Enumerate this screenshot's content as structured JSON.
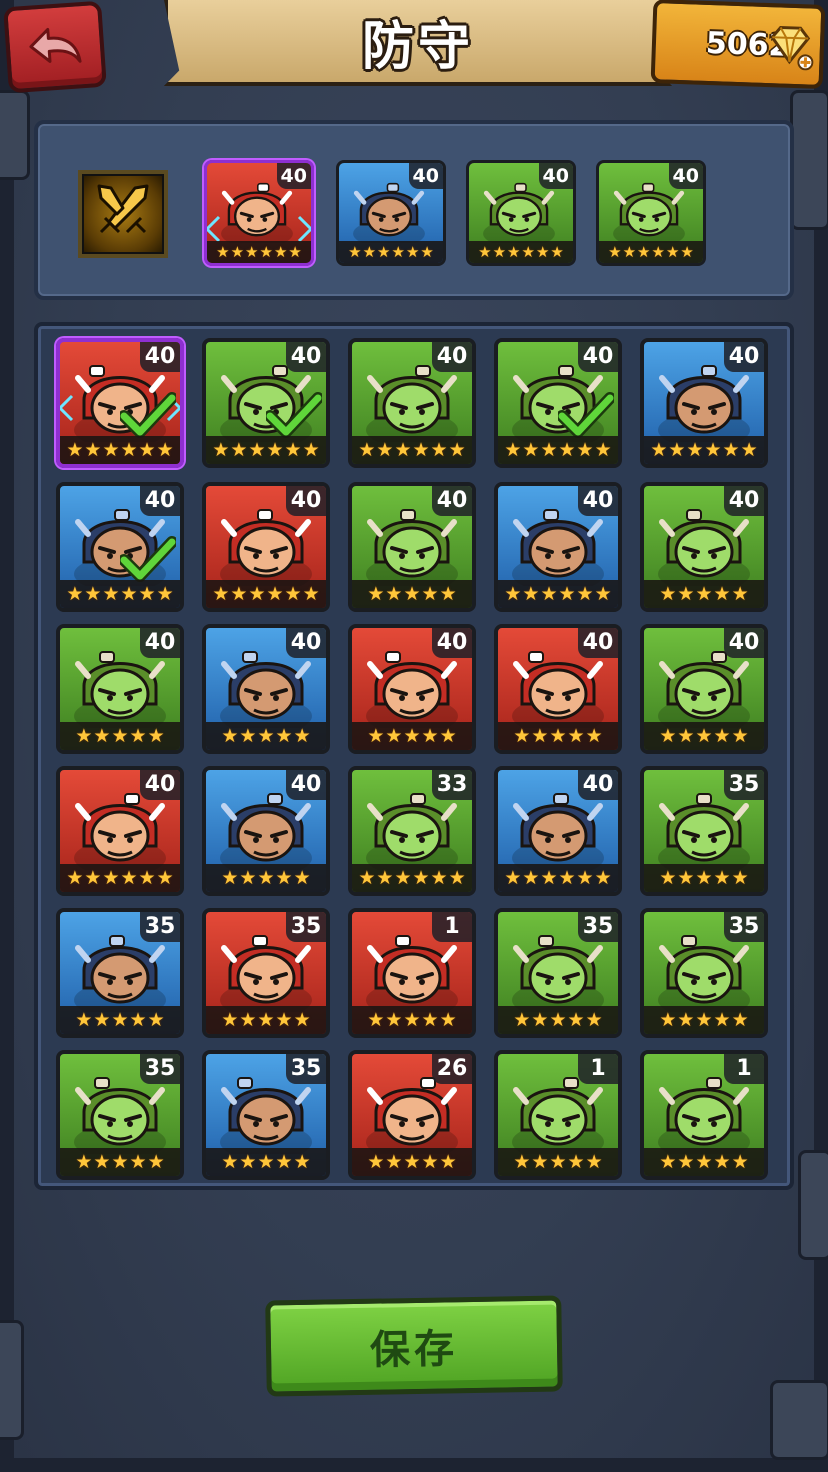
{
  "header": {
    "title": "防守",
    "gems": "5062"
  },
  "colors": {
    "frame": "#2a3345",
    "panel": "#3f5270",
    "accent_gold": "#ffc63a",
    "save_green": "#6cc23a",
    "back_red": "#c42f32"
  },
  "team": {
    "skill_icon": "crossed-swords-icon",
    "slots": [
      {
        "level": "40",
        "stars": 6,
        "bg": "red",
        "purple": true
      },
      {
        "level": "40",
        "stars": 6,
        "bg": "blue",
        "purple": false
      },
      {
        "level": "40",
        "stars": 6,
        "bg": "green",
        "purple": false
      },
      {
        "level": "40",
        "stars": 6,
        "bg": "green",
        "purple": false
      }
    ]
  },
  "roster": [
    {
      "level": "40",
      "stars": 6,
      "bg": "red",
      "selected": true,
      "purple": true
    },
    {
      "level": "40",
      "stars": 6,
      "bg": "green",
      "selected": true
    },
    {
      "level": "40",
      "stars": 6,
      "bg": "green",
      "selected": false
    },
    {
      "level": "40",
      "stars": 6,
      "bg": "green",
      "selected": true
    },
    {
      "level": "40",
      "stars": 6,
      "bg": "blue",
      "selected": false
    },
    {
      "level": "40",
      "stars": 6,
      "bg": "blue",
      "selected": true
    },
    {
      "level": "40",
      "stars": 6,
      "bg": "red",
      "selected": false
    },
    {
      "level": "40",
      "stars": 5,
      "bg": "green",
      "selected": false
    },
    {
      "level": "40",
      "stars": 6,
      "bg": "blue",
      "selected": false
    },
    {
      "level": "40",
      "stars": 5,
      "bg": "green",
      "selected": false
    },
    {
      "level": "40",
      "stars": 5,
      "bg": "green",
      "selected": false
    },
    {
      "level": "40",
      "stars": 5,
      "bg": "blue",
      "selected": false
    },
    {
      "level": "40",
      "stars": 5,
      "bg": "red",
      "selected": false
    },
    {
      "level": "40",
      "stars": 5,
      "bg": "red",
      "selected": false
    },
    {
      "level": "40",
      "stars": 5,
      "bg": "green",
      "selected": false
    },
    {
      "level": "40",
      "stars": 6,
      "bg": "red",
      "selected": false
    },
    {
      "level": "40",
      "stars": 5,
      "bg": "blue",
      "selected": false
    },
    {
      "level": "33",
      "stars": 6,
      "bg": "green",
      "selected": false
    },
    {
      "level": "40",
      "stars": 6,
      "bg": "blue",
      "selected": false
    },
    {
      "level": "35",
      "stars": 5,
      "bg": "green",
      "selected": false
    },
    {
      "level": "35",
      "stars": 5,
      "bg": "blue",
      "selected": false
    },
    {
      "level": "35",
      "stars": 5,
      "bg": "red",
      "selected": false
    },
    {
      "level": "1",
      "stars": 5,
      "bg": "red",
      "selected": false
    },
    {
      "level": "35",
      "stars": 5,
      "bg": "green",
      "selected": false
    },
    {
      "level": "35",
      "stars": 5,
      "bg": "green",
      "selected": false
    },
    {
      "level": "35",
      "stars": 5,
      "bg": "green",
      "selected": false
    },
    {
      "level": "35",
      "stars": 5,
      "bg": "blue",
      "selected": false
    },
    {
      "level": "26",
      "stars": 5,
      "bg": "red",
      "selected": false
    },
    {
      "level": "1",
      "stars": 5,
      "bg": "green",
      "selected": false
    },
    {
      "level": "1",
      "stars": 5,
      "bg": "green",
      "selected": false
    }
  ],
  "save_button": {
    "label": "保存"
  }
}
